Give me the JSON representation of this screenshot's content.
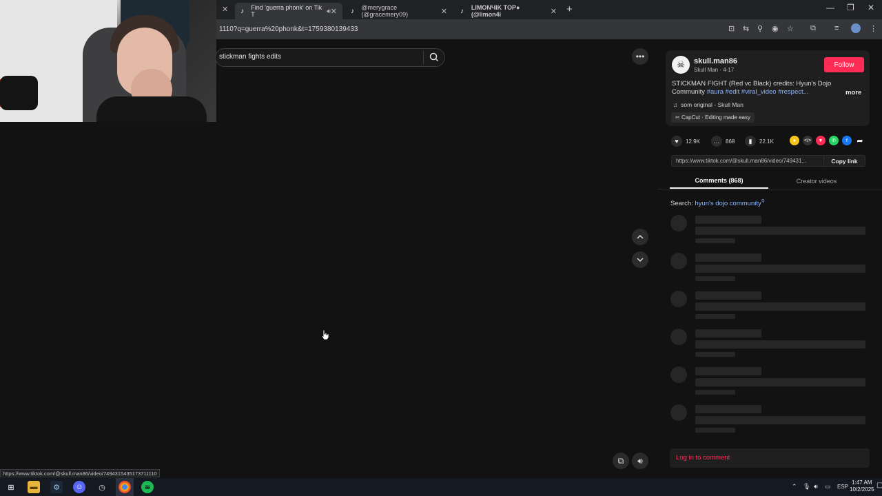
{
  "browser": {
    "tabs": [
      {
        "label": "Find 'guerra phonk' on Tik T",
        "active": true
      },
      {
        "label": "@merygrace (@gracemery09)",
        "active": false
      },
      {
        "label": "LIMONЧIK TOP● (@limon4i",
        "active": false
      }
    ],
    "url": "1110?q=guerra%20phonk&t=1759380139433",
    "status_url": "https://www.tiktok.com/@skull.man86/video/7494315435173711110"
  },
  "search": {
    "query": "stickman fights edits"
  },
  "post": {
    "author": "skull.man86",
    "author_sub": "Skull Man · 4-17",
    "follow_label": "Follow",
    "description": "STICKMAN FIGHT (Red vc Black) credits: Hyun's Dojo Community",
    "tags": "#aura #edit #viral_video #respect...",
    "more_label": "more",
    "music": "som original - Skull Man",
    "capcut": "CapCut · Editing made easy",
    "likes": "12.9K",
    "comments": "868",
    "saves": "22.1K",
    "link": "https://www.tiktok.com/@skull.man86/video/749431...",
    "copy_label": "Copy link"
  },
  "panel": {
    "tab_comments": "Comments (868)",
    "tab_creator": "Creator videos",
    "search_prefix": "Search:",
    "search_term": "hyun's dojo community",
    "login_comment": "Log in to comment"
  },
  "taskbar": {
    "language": "ESP",
    "time": "1:47 AM",
    "date": "10/2/2025"
  },
  "colors": {
    "accent": "#fe2c55",
    "link": "#8fb7ff",
    "background": "#121212"
  }
}
